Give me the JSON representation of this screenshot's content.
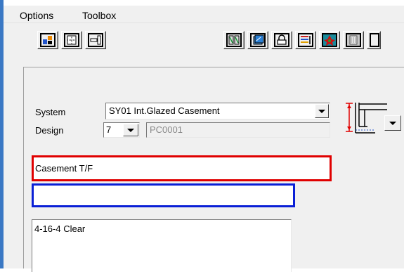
{
  "menu": {
    "items": [
      "Options",
      "Toolbox"
    ]
  },
  "toolbar": {
    "left_icons": [
      "component-icon",
      "grid-icon",
      "panel-icon"
    ],
    "right_icons": [
      "mullion-icon",
      "glazing-icon",
      "handle-icon",
      "color-bars-icon",
      "color-icon",
      "texture-icon"
    ]
  },
  "form": {
    "system_label": "System",
    "system_value": "SY01  Int.Glazed Casement",
    "design_label": "Design",
    "design_value": "7",
    "design_code": "PC0001",
    "description": "Casement T/F",
    "reference": "",
    "glass": "4-16-4 Clear"
  },
  "colors": {
    "frame": "#3a78c4",
    "red_highlight": "#e00000",
    "blue_highlight": "#0a1fd6"
  }
}
